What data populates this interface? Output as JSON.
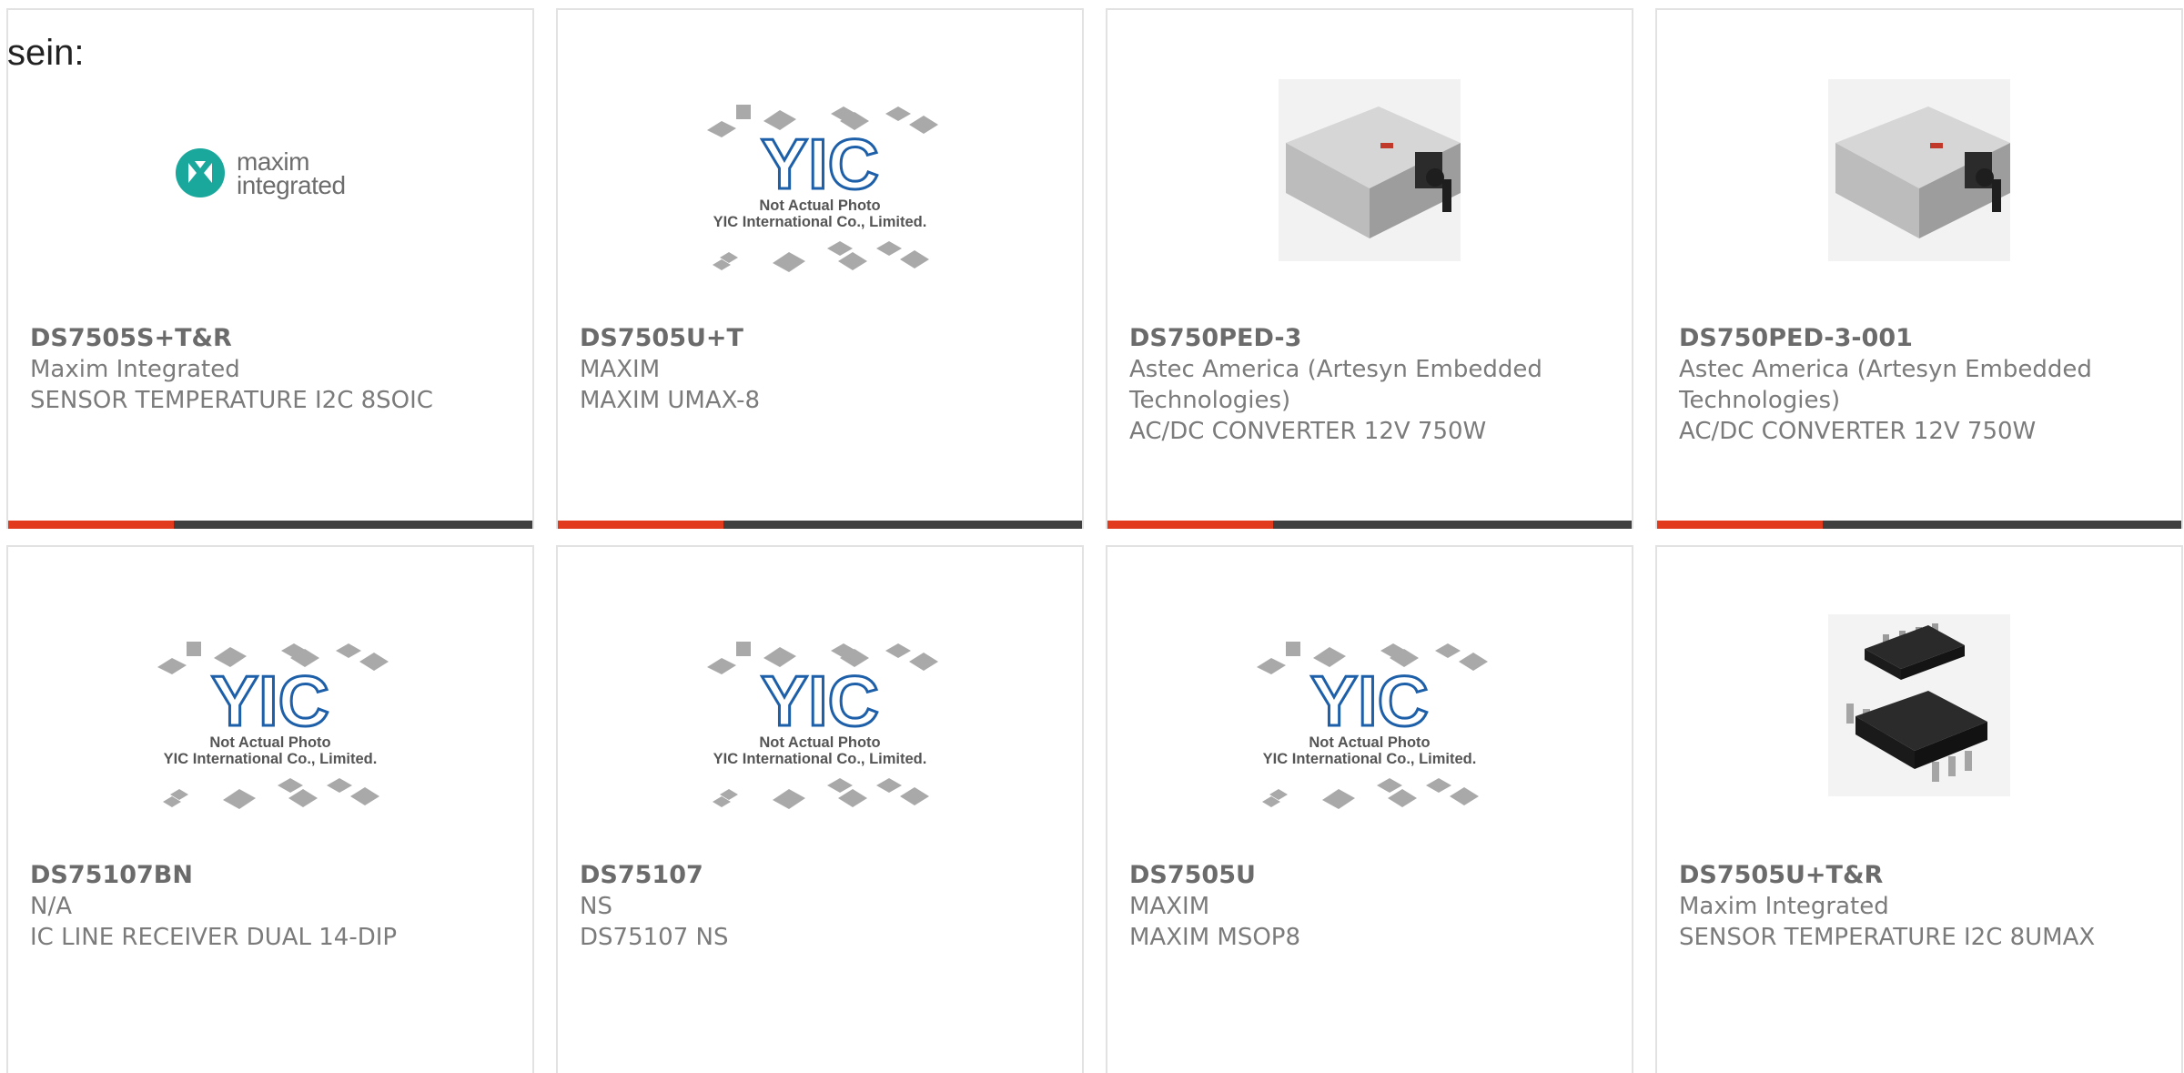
{
  "intro_text": "sein:",
  "images": {
    "not_actual_photo": "Not Actual Photo",
    "yic_company": "YIC International Co., Limited.",
    "yic_logo_text": "YIC",
    "maxim_logo_line1": "maxim",
    "maxim_logo_line2": "integrated"
  },
  "colors": {
    "accent": "#e13a1c",
    "bar_dark": "#3f3f3f",
    "border": "#e2e2e2",
    "text": "#7b7b7b",
    "maxim_teal": "#1aa89c"
  },
  "products": [
    {
      "part_number": "DS7505S+T&R",
      "manufacturer": "Maxim Integrated",
      "description": "SENSOR TEMPERATURE I2C 8SOIC",
      "image": "maxim-logo"
    },
    {
      "part_number": "DS7505U+T",
      "manufacturer": "MAXIM",
      "description": "MAXIM UMAX-8",
      "image": "yic-placeholder"
    },
    {
      "part_number": "DS750PED-3",
      "manufacturer": "Astec America (Artesyn Embedded Technologies)",
      "description": "AC/DC CONVERTER 12V 750W",
      "image": "power-supply"
    },
    {
      "part_number": "DS750PED-3-001",
      "manufacturer": "Astec America (Artesyn Embedded Technologies)",
      "description": "AC/DC CONVERTER 12V 750W",
      "image": "power-supply"
    },
    {
      "part_number": "DS75107BN",
      "manufacturer": "N/A",
      "description": "IC LINE RECEIVER DUAL 14-DIP",
      "image": "yic-placeholder"
    },
    {
      "part_number": "DS75107",
      "manufacturer": "NS",
      "description": "DS75107 NS",
      "image": "yic-placeholder"
    },
    {
      "part_number": "DS7505U",
      "manufacturer": "MAXIM",
      "description": "MAXIM MSOP8",
      "image": "yic-placeholder"
    },
    {
      "part_number": "DS7505U+T&R",
      "manufacturer": "Maxim Integrated",
      "description": "SENSOR TEMPERATURE I2C 8UMAX",
      "image": "ic-chip"
    }
  ]
}
